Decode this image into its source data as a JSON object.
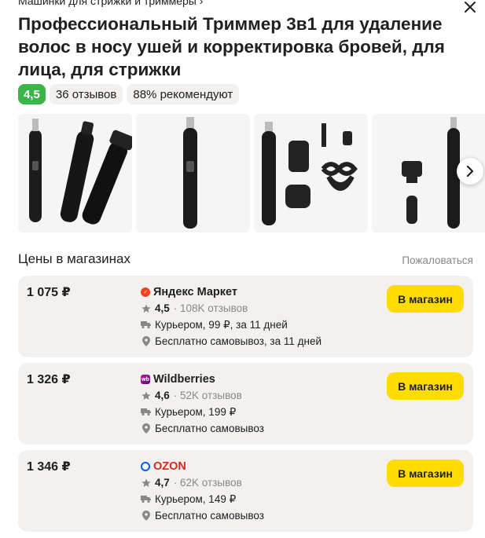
{
  "breadcrumb": "Машинки для стрижки и триммеры ›",
  "product": {
    "title": "Профессиональный Триммер 3в1 для удаление волос в носу ушей и корректировка бровей, для лица, для стрижки",
    "rating": "4,5",
    "reviews": "36 отзывов",
    "recommend": "88% рекомендуют"
  },
  "gallery": {
    "icons": [
      "trimmer-set-image",
      "trimmer-single-image",
      "trimmer-accessories-image",
      "trimmer-heads-image"
    ]
  },
  "prices_section": {
    "title": "Цены в магазинах",
    "complain_label": "Пожаловаться"
  },
  "offers": [
    {
      "price": "1 075 ₽",
      "shop": "Яндекс Маркет",
      "rating": "4,5",
      "reviews": "· 108K отзывов",
      "delivery": "Курьером, 99 ₽, за 11 дней",
      "pickup": "Бесплатно самовывоз, за 11 дней",
      "button": "В магазин"
    },
    {
      "price": "1 326 ₽",
      "shop": "Wildberries",
      "rating": "4,6",
      "reviews": "· 52K отзывов",
      "delivery": "Курьером, 199 ₽",
      "pickup": "Бесплатно самовывоз",
      "button": "В магазин"
    },
    {
      "price": "1 346 ₽",
      "shop": "OZON",
      "rating": "4,7",
      "reviews": "· 62K отзывов",
      "delivery": "Курьером, 149 ₽",
      "pickup": "Бесплатно самовывоз",
      "button": "В магазин"
    }
  ],
  "colors": {
    "rating_badge": "#3ab54a",
    "button": "#ffdc00",
    "card_bg": "#f2f1ef",
    "ozon": "#d6281f"
  }
}
